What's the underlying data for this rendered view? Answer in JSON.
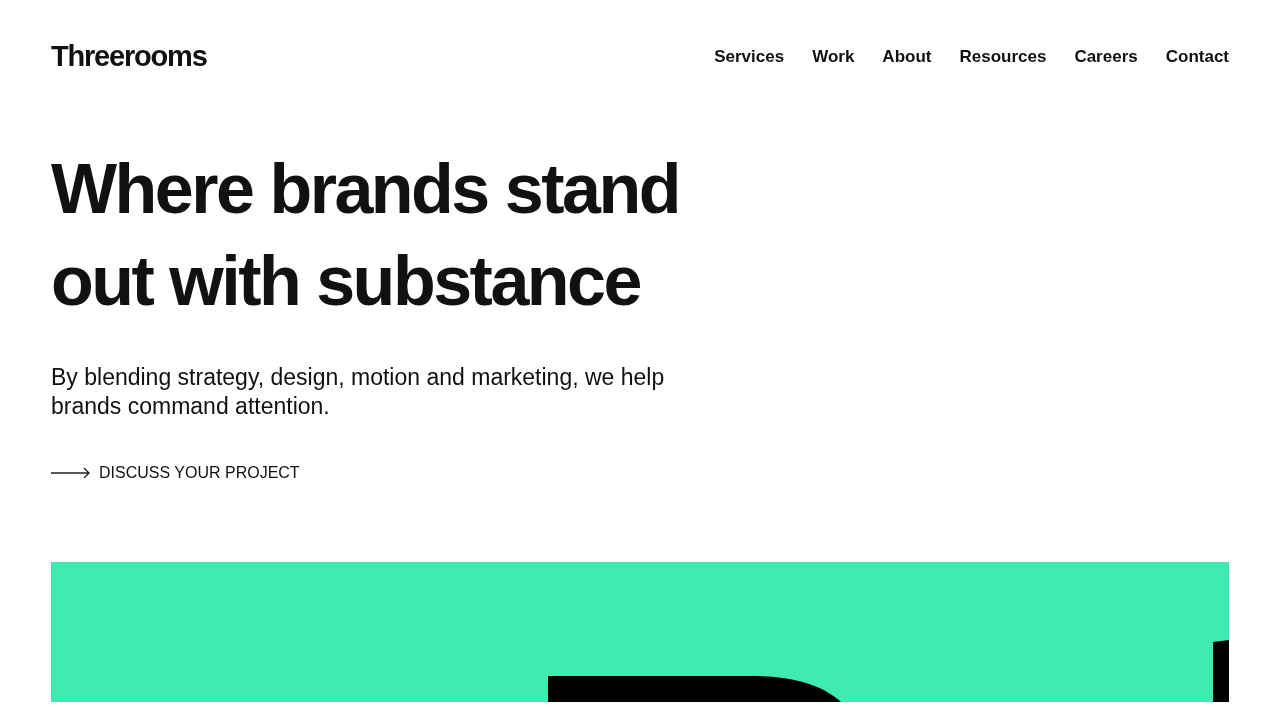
{
  "logo": "Threerooms",
  "nav": [
    "Services",
    "Work",
    "About",
    "Resources",
    "Careers",
    "Contact"
  ],
  "hero": {
    "headline": "Where brands stand out with substance",
    "text": "By blending strategy, design, motion and marketing, we help brands command attention.",
    "cta": "DISCUSS YOUR PROJECT"
  }
}
